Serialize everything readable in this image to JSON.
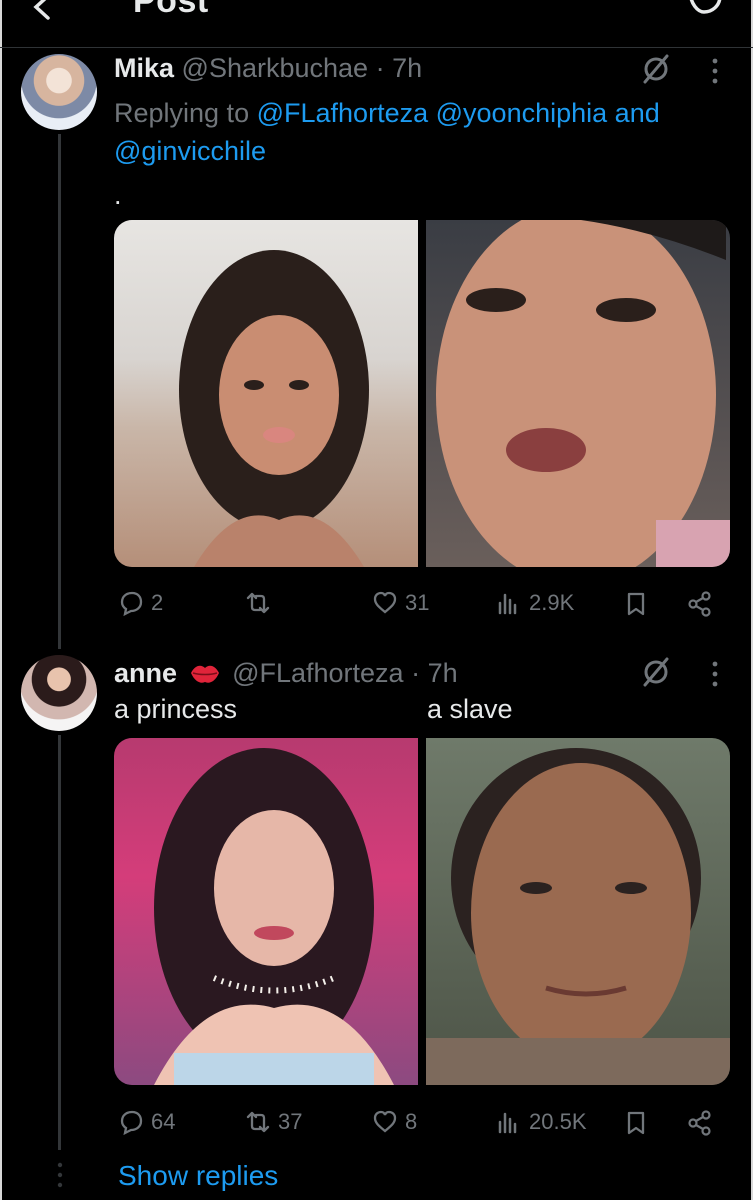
{
  "header": {
    "title": "Post"
  },
  "tweet1": {
    "display_name": "Mika",
    "handle": "@Sharkbuchae",
    "time": "· 7h",
    "replying_prefix": "Replying to",
    "mentions": [
      "@FLafhorteza",
      "@yoonchiphia",
      "and",
      "@ginvicchile"
    ],
    "text": ".",
    "stats": {
      "replies": "2",
      "reposts": "",
      "likes": "31",
      "views": "2.9K"
    }
  },
  "tweet2": {
    "display_name": "anne",
    "handle": "@FLafhorteza",
    "time": "· 7h",
    "caption_left": "a princess",
    "caption_right": "a slave",
    "stats": {
      "replies": "64",
      "reposts": "37",
      "likes": "8",
      "views": "20.5K"
    }
  },
  "show_replies": "Show replies",
  "icons": [
    "back-arrow-icon",
    "grok-icon",
    "more-icon",
    "reply-icon",
    "repost-icon",
    "like-icon",
    "views-icon",
    "bookmark-icon",
    "share-icon",
    "lips-emoji"
  ],
  "colors": {
    "background": "#000000",
    "text": "#e7e9ea",
    "muted": "#71767b",
    "link": "#1d9bf0",
    "lips": "#e0243a"
  }
}
